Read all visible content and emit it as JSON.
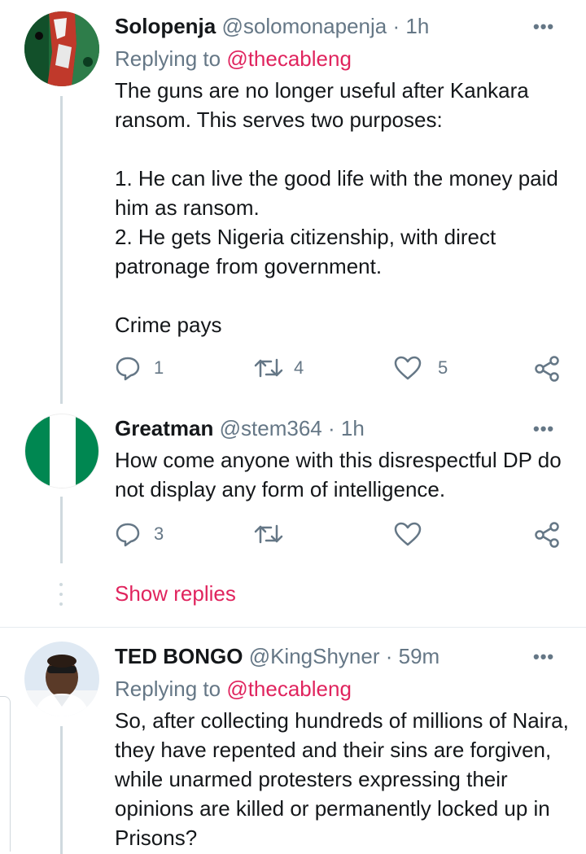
{
  "tweets": [
    {
      "name": "Solopenja",
      "handle": "@solomonapenja",
      "separator": "·",
      "time": "1h",
      "replying_label": "Replying to",
      "replying_to": "@thecableng",
      "text": "The guns are no longer useful after Kankara ransom. This serves two purposes:\n\n1. He can live the good life with the money paid him as ransom.\n2. He gets Nigeria citizenship, with direct patronage from government.\n\nCrime pays",
      "reply_count": "1",
      "retweet_count": "4",
      "like_count": "5",
      "more": "•••"
    },
    {
      "name": "Greatman",
      "handle": "@stem364",
      "separator": "·",
      "time": "1h",
      "text": "How come anyone with this disrespectful DP do not display any form of intelligence.",
      "reply_count": "3",
      "more": "•••"
    },
    {
      "name": "TED BONGO",
      "handle": "@KingShyner",
      "separator": "·",
      "time": "59m",
      "replying_label": "Replying to",
      "replying_to": "@thecableng",
      "text": "So, after collecting hundreds of millions of Naira, they have repented and their sins are forgiven, while unarmed protesters expressing their opinions are killed or permanently locked up in Prisons?",
      "more": "•••"
    }
  ],
  "show_replies": "Show replies",
  "colors": {
    "accent": "#e0245e",
    "secondary_text": "#657786",
    "thread_line": "#cfd9de",
    "nigeria_green": "#008751"
  }
}
